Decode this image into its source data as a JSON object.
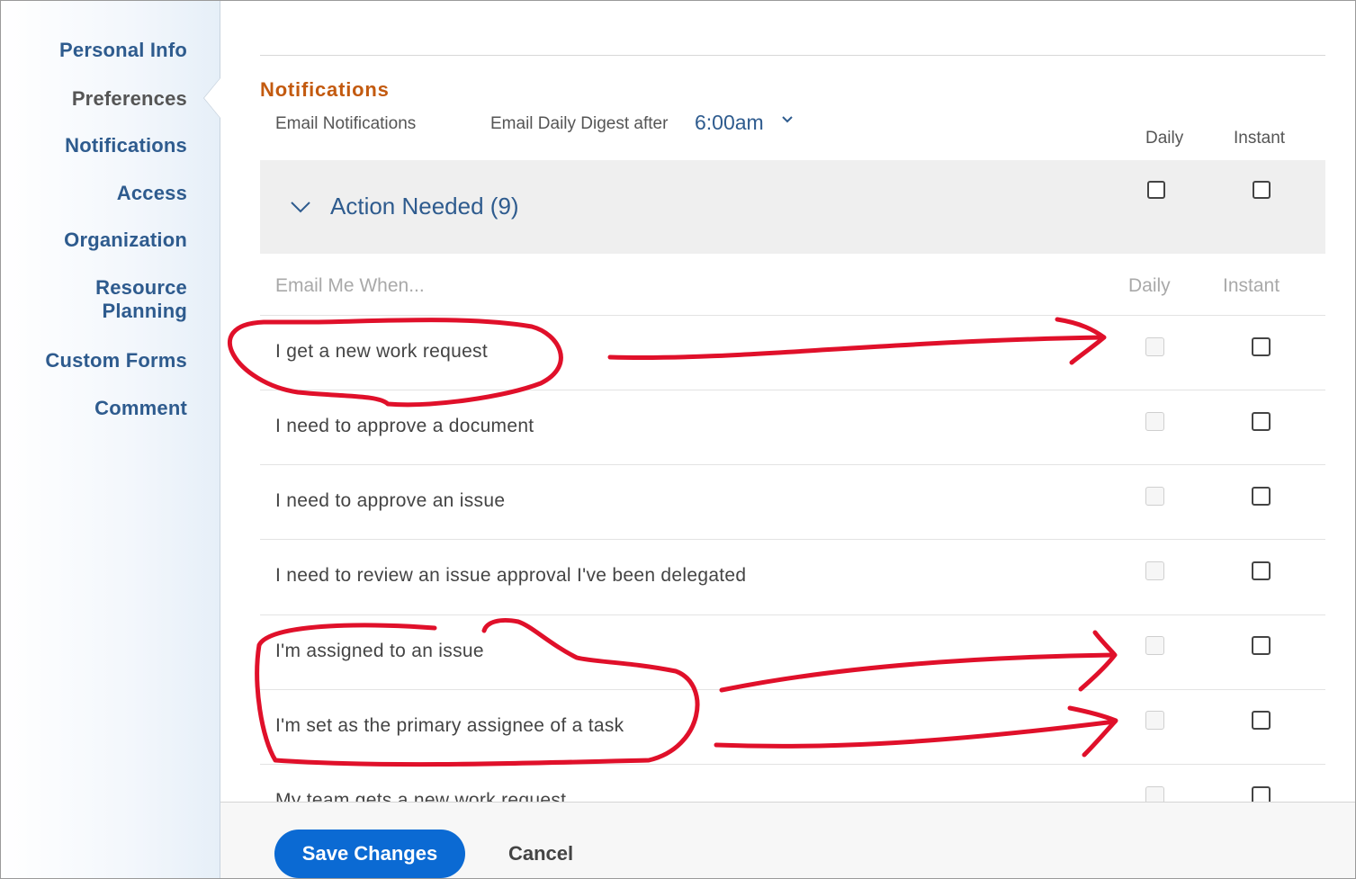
{
  "sidebar": {
    "items": [
      {
        "label": "Personal Info"
      },
      {
        "label": "Preferences"
      },
      {
        "label": "Notifications"
      },
      {
        "label": "Access"
      },
      {
        "label": "Organization"
      },
      {
        "label": "Resource Planning"
      },
      {
        "label": "Custom Forms"
      },
      {
        "label": "Comment"
      }
    ],
    "active": "Preferences"
  },
  "notifications": {
    "title": "Notifications",
    "email_notifications_label": "Email Notifications",
    "digest_label": "Email Daily Digest after",
    "digest_value": "6:00am",
    "columns": {
      "daily": "Daily",
      "instant": "Instant"
    },
    "group": {
      "title": "Action Needed (9)",
      "expanded": true,
      "daily_checked": false,
      "instant_checked": false
    },
    "subheader": {
      "label": "Email Me When...",
      "daily": "Daily",
      "instant": "Instant"
    },
    "rows": [
      {
        "label": "I get a new work request",
        "daily_enabled": false,
        "instant_checked": false
      },
      {
        "label": "I need to approve a document",
        "daily_enabled": false,
        "instant_checked": false
      },
      {
        "label": "I need to approve an issue",
        "daily_enabled": false,
        "instant_checked": false
      },
      {
        "label": "I need to review an issue approval I've been delegated",
        "daily_enabled": false,
        "instant_checked": false
      },
      {
        "label": "I'm assigned to an issue",
        "daily_enabled": false,
        "instant_checked": false
      },
      {
        "label": "I'm set as the primary assignee of a task",
        "daily_enabled": false,
        "instant_checked": false
      },
      {
        "label": "My team gets a new work request",
        "daily_enabled": false,
        "instant_checked": false
      }
    ]
  },
  "footer": {
    "save_label": "Save Changes",
    "cancel_label": "Cancel"
  },
  "colors": {
    "accent": "#0b6ad3",
    "nav": "#2e5b8e",
    "section_title": "#c35a0f",
    "annotation": "#e0102a"
  }
}
